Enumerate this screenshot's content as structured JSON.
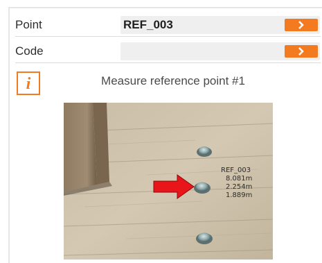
{
  "form": {
    "point": {
      "label": "Point",
      "value": "REF_003"
    },
    "code": {
      "label": "Code",
      "value": ""
    }
  },
  "info": {
    "icon_letter": "i",
    "icon": "info-icon",
    "instruction": "Measure reference point #1"
  },
  "photo": {
    "point_name": "REF_003",
    "readings": [
      "8.081m",
      "2.254m",
      "1.889m"
    ]
  },
  "colors": {
    "accent": "#f47a1f",
    "arrow": "#e8161b"
  }
}
